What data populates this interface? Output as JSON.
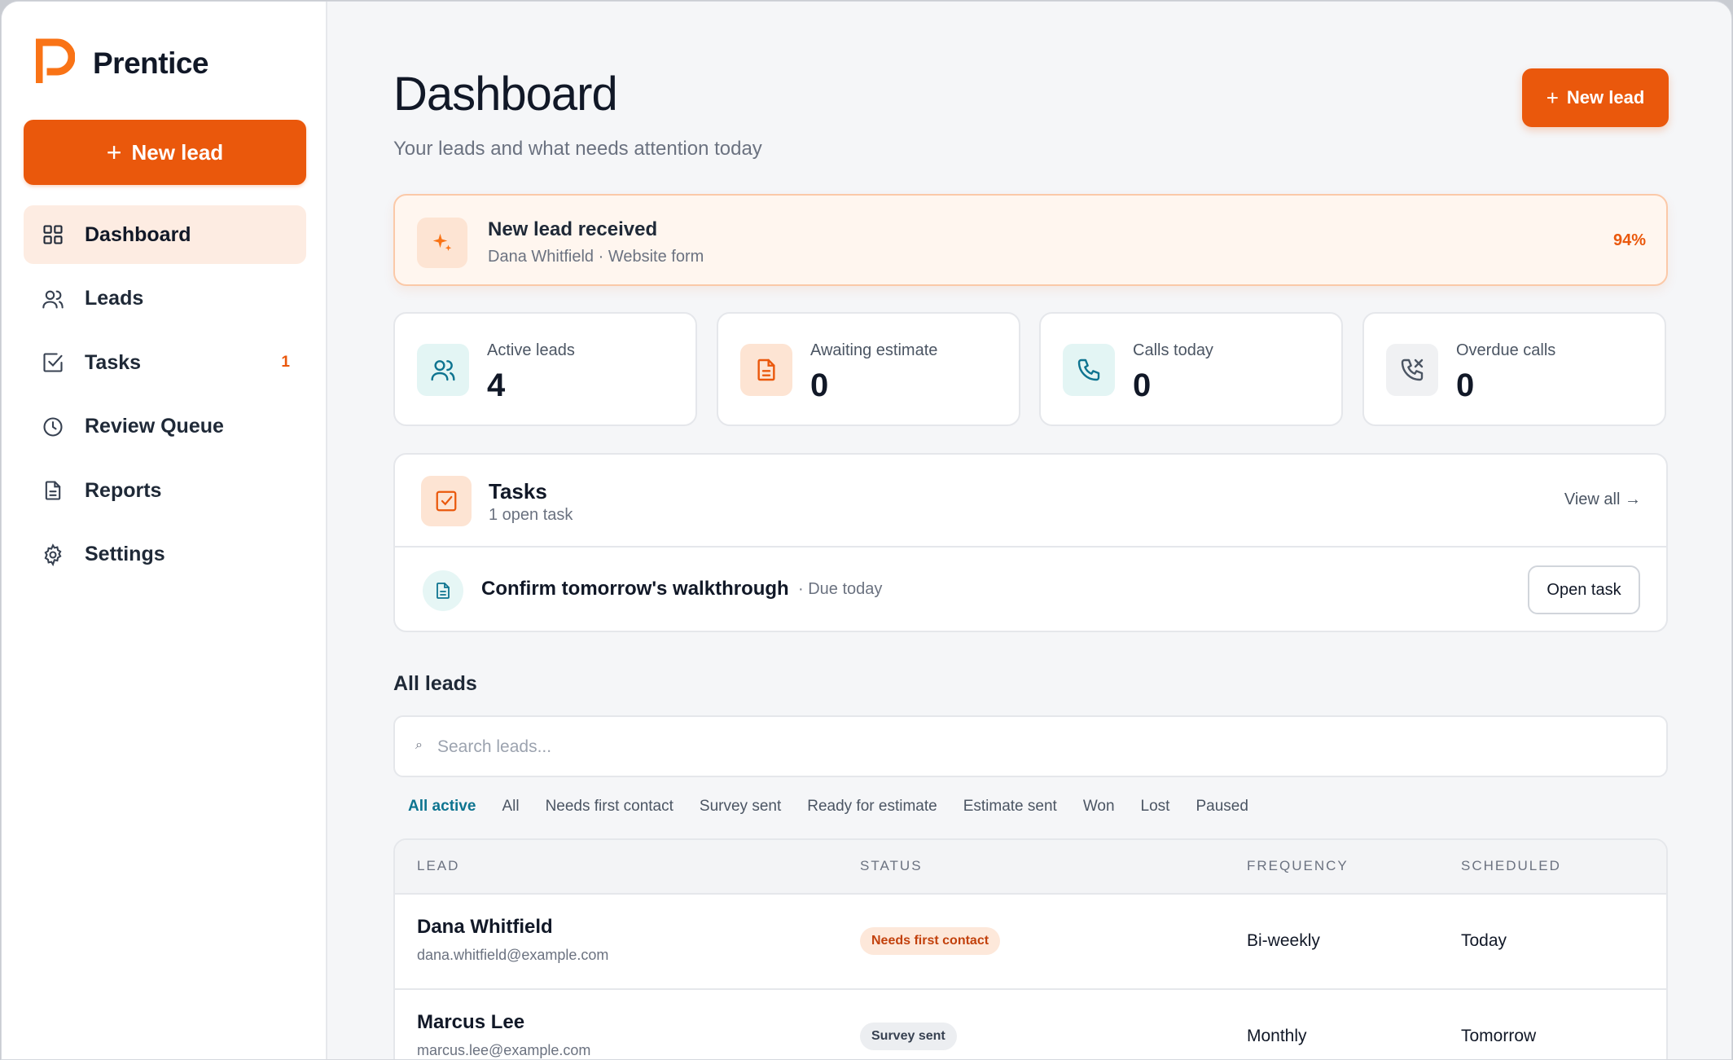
{
  "app": {
    "brand": "Prentice",
    "accent": "#ea580c",
    "teal": "#0e7490"
  },
  "sidebar": {
    "new_lead": "New lead",
    "items": [
      {
        "label": "Dashboard",
        "icon": "grid-icon",
        "active": true
      },
      {
        "label": "Leads",
        "icon": "users-icon"
      },
      {
        "label": "Tasks",
        "icon": "checkbox-icon",
        "badge": "1"
      },
      {
        "label": "Review Queue",
        "icon": "clock-icon"
      },
      {
        "label": "Reports",
        "icon": "document-icon"
      },
      {
        "label": "Settings",
        "icon": "gear-icon"
      }
    ]
  },
  "header": {
    "title": "Dashboard",
    "subtitle": "Your leads and what needs attention today",
    "new_lead": "New lead"
  },
  "alert": {
    "title": "New lead received",
    "subtitle": "Dana Whitfield · Website form",
    "score": "94%"
  },
  "stats": [
    {
      "label": "Active leads",
      "value": "4",
      "icon": "users-icon"
    },
    {
      "label": "Awaiting estimate",
      "value": "0",
      "icon": "document-icon"
    },
    {
      "label": "Calls today",
      "value": "0",
      "icon": "phone-icon"
    },
    {
      "label": "Overdue calls",
      "value": "0",
      "icon": "phone-missed-icon"
    }
  ],
  "tasks": {
    "title": "Tasks",
    "subtitle": "1 open task",
    "view_all": "View all →",
    "items": [
      {
        "title": "Confirm tomorrow's walkthrough",
        "due": "· Due today",
        "action": "Open task"
      }
    ]
  },
  "leads": {
    "title": "All leads",
    "search_placeholder": "Search leads...",
    "filters": [
      "All active",
      "All",
      "Needs first contact",
      "Survey sent",
      "Ready for estimate",
      "Estimate sent",
      "Won",
      "Lost",
      "Paused"
    ],
    "columns": [
      "LEAD",
      "STATUS",
      "FREQUENCY",
      "SCHEDULED"
    ],
    "rows": [
      {
        "name": "Dana Whitfield",
        "email": "dana.whitfield@example.com",
        "status": "Needs first contact",
        "frequency": "Bi-weekly",
        "scheduled": "Today"
      },
      {
        "name": "Marcus Lee",
        "email": "marcus.lee@example.com",
        "status": "Survey sent",
        "frequency": "Monthly",
        "scheduled": "Tomorrow"
      }
    ]
  }
}
